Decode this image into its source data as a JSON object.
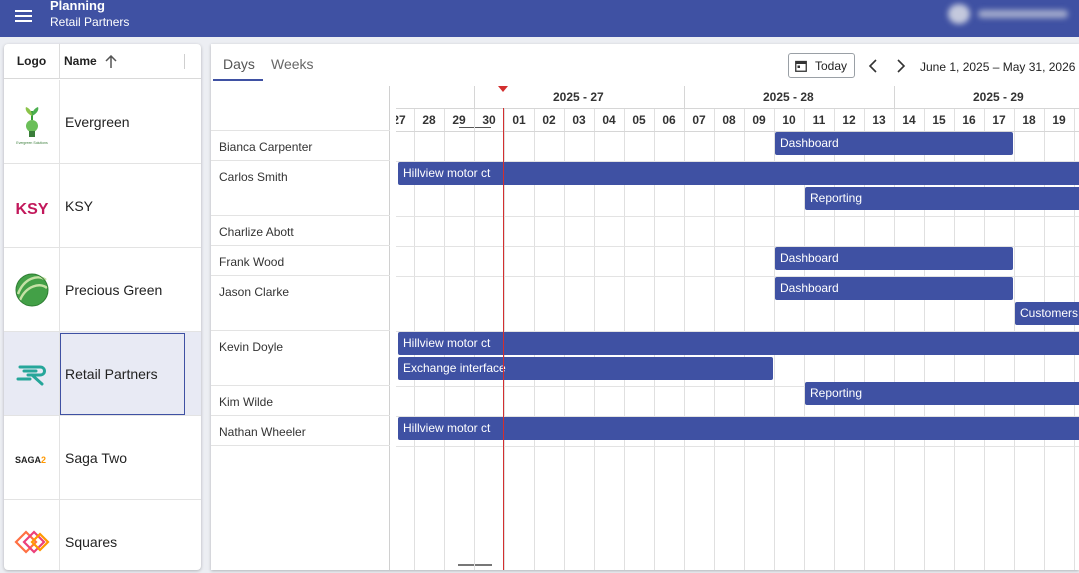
{
  "header": {
    "title": "Planning",
    "subtitle": "Retail Partners",
    "menu_icon": "hamburger-menu-icon",
    "user_name_blurred": "User Name"
  },
  "partners": {
    "col_logo": "Logo",
    "col_name": "Name",
    "sort_icon": "arrow-up-icon",
    "items": [
      {
        "name": "Evergreen",
        "logo_caption": "Evergreen Solutions"
      },
      {
        "name": "KSY",
        "logo_text": "KSY"
      },
      {
        "name": "Precious Green"
      },
      {
        "name": "Retail Partners",
        "selected": true
      },
      {
        "name": "Saga Two",
        "logo_text": "SAGA",
        "logo_text_accent": "2"
      },
      {
        "name": "Squares"
      }
    ]
  },
  "scheduler": {
    "tabs": [
      "Days",
      "Weeks"
    ],
    "active_tab": "Days",
    "today_label": "Today",
    "date_range": "June 1, 2025 – May 31, 2026",
    "weeks": [
      "2025 - 27",
      "2025 - 28",
      "2025 - 29"
    ],
    "days": [
      "27",
      "28",
      "29",
      "30",
      "01",
      "02",
      "03",
      "04",
      "05",
      "06",
      "07",
      "08",
      "09",
      "10",
      "11",
      "12",
      "13",
      "14",
      "15",
      "16",
      "17",
      "18",
      "19"
    ],
    "resources": [
      "Bianca Carpenter",
      "Carlos Smith",
      "Charlize Abott",
      "Frank Wood",
      "Jason Clarke",
      "Kevin Doyle",
      "Kim Wilde",
      "Nathan Wheeler"
    ],
    "events": [
      {
        "label": "Dashboard",
        "resource": "Bianca Carpenter",
        "start": "10",
        "end": "17"
      },
      {
        "label": "Hillview motor ct",
        "resource": "Carlos Smith",
        "start": "27",
        "end": "19+"
      },
      {
        "label": "Reporting",
        "resource": "Carlos Smith",
        "start": "11",
        "end": "19+"
      },
      {
        "label": "Dashboard",
        "resource": "Frank Wood",
        "start": "10",
        "end": "17"
      },
      {
        "label": "Dashboard",
        "resource": "Jason Clarke",
        "start": "10",
        "end": "17"
      },
      {
        "label": "Customers",
        "resource": "Jason Clarke",
        "start": "18",
        "end": "19+"
      },
      {
        "label": "Hillview motor ct",
        "resource": "Kevin Doyle",
        "start": "27",
        "end": "19+"
      },
      {
        "label": "Exchange interface",
        "resource": "Kevin Doyle",
        "start": "27",
        "end": "09"
      },
      {
        "label": "Reporting",
        "resource": "Kevin Doyle",
        "start": "11",
        "end": "19+"
      },
      {
        "label": "Hillview motor ct",
        "resource": "Nathan Wheeler",
        "start": "27",
        "end": "19+"
      }
    ]
  }
}
